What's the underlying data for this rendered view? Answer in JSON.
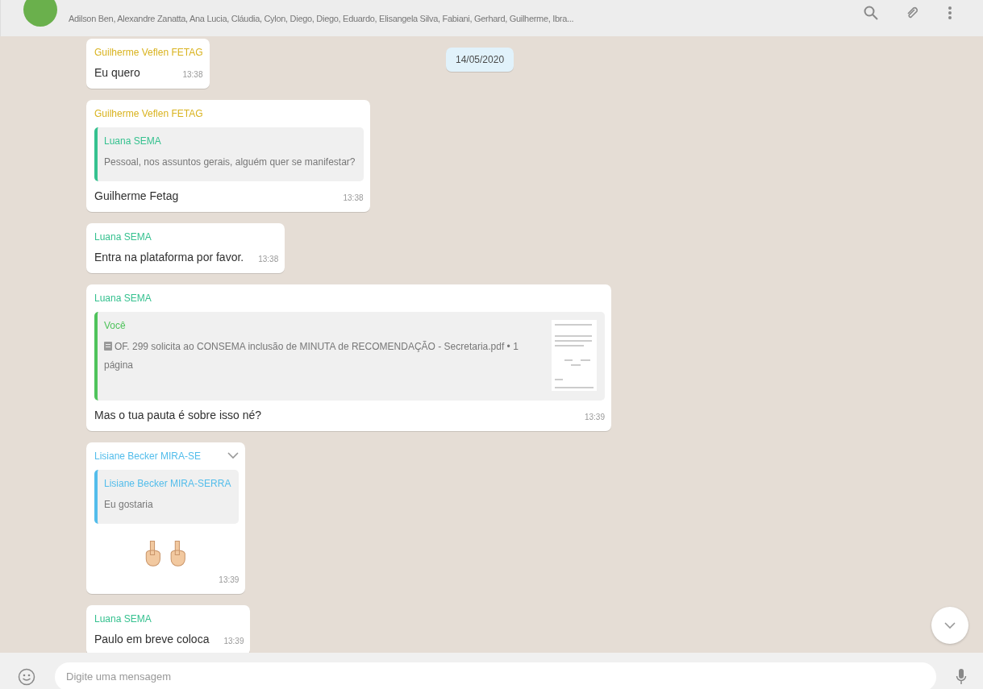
{
  "header": {
    "participants": "Adilson Ben, Alexandre Zanatta, Ana Lucia, Cláudia, Cylon, Diego, Diego, Eduardo, Elisangela Silva, Fabiani, Gerhard, Guilherme, Ibra..."
  },
  "date_chip": "14/05/2020",
  "messages": [
    {
      "kind": "text",
      "sender": "Guilherme Veflen FETAG",
      "color": "#d9b31f",
      "text": "Eu quero",
      "time": "13:38"
    },
    {
      "kind": "quote",
      "sender": "Guilherme Veflen FETAG",
      "color": "#d9b31f",
      "quote": {
        "sender": "Luana SEMA",
        "color": "#35c18f",
        "text": "Pessoal, nos assuntos gerais, alguém quer se manifestar?"
      },
      "text": "Guilherme Fetag",
      "time": "13:38"
    },
    {
      "kind": "text",
      "sender": "Luana SEMA",
      "color": "#35c18f",
      "text": "Entra na plataforma por favor.",
      "time": "13:38"
    },
    {
      "kind": "document_quote",
      "sender": "Luana SEMA",
      "color": "#35c18f",
      "quote": {
        "sender": "Você",
        "color": "#4fc35b",
        "text": "OF. 299 solicita ao CONSEMA inclusão de MINUTA de RECOMENDAÇÃO - Secretaria.pdf • 1 página"
      },
      "text": "Mas o tua pauta é sobre isso né?",
      "time": "13:39"
    },
    {
      "kind": "emoji_quote",
      "sender": "Lisiane Becker MIRA-SE",
      "color": "#53bdeb",
      "quote": {
        "sender": "Lisiane Becker MIRA-SERRA",
        "color": "#53bdeb",
        "text": "Eu gostaria"
      },
      "time": "13:39"
    },
    {
      "kind": "text",
      "sender": "Luana SEMA",
      "color": "#35c18f",
      "text": "Paulo em breve coloca",
      "time": "13:39"
    },
    {
      "kind": "partial"
    }
  ],
  "composer": {
    "placeholder": "Digite uma mensagem"
  }
}
